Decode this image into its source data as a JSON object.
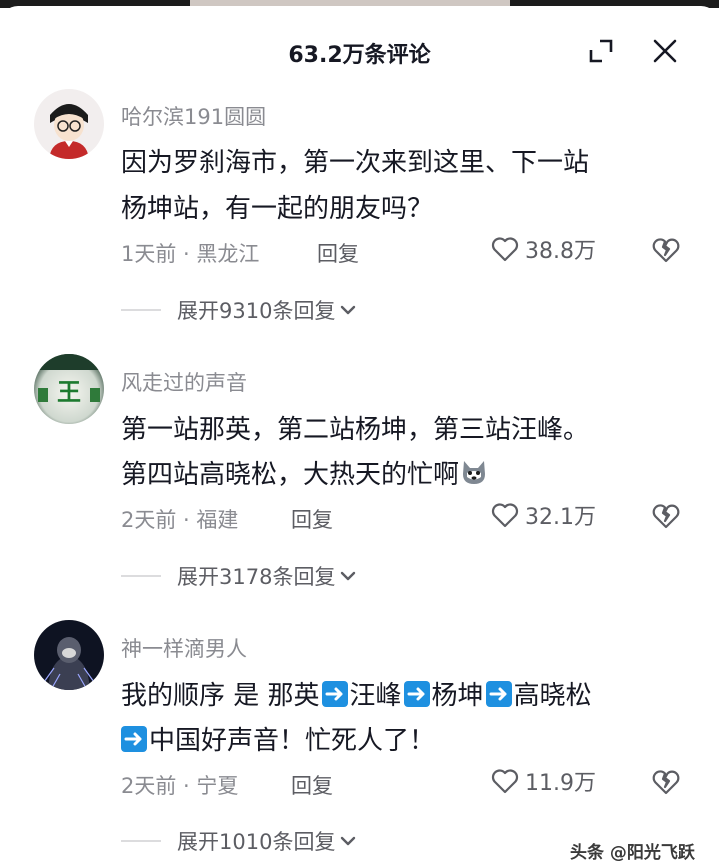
{
  "header": {
    "title": "63.2万条评论"
  },
  "icons": {
    "expand": "minimize-corner-icon",
    "close": "close-icon",
    "like": "heart-outline-icon",
    "dislike": "broken-heart-icon",
    "arrow_emoji": "right-arrow-emoji",
    "wolf_emoji": "wolf-emoji"
  },
  "comments": [
    {
      "username": "哈尔滨191圆圆",
      "lines": [
        "因为罗刹海市，第一次来到这里、下一站",
        "杨坤站，有一起的朋友吗？"
      ],
      "meta": "1天前 · 黑龙江",
      "reply_label": "回复",
      "likes": "38.8万",
      "expand_label": "展开9310条回复"
    },
    {
      "username": "风走过的声音",
      "lines": [
        "第一站那英，第二站杨坤，第三站汪峰。",
        "第四站高晓松，大热天的忙啊"
      ],
      "meta": "2天前 · 福建",
      "reply_label": "回复",
      "likes": "32.1万",
      "expand_label": "展开3178条回复"
    },
    {
      "username": "神一样滴男人",
      "segments_line1": [
        "我的顺序 是 那英",
        "汪峰",
        "杨坤",
        "高晓松"
      ],
      "segments_line2": [
        "中国好声音！忙死人了！"
      ],
      "meta": "2天前 · 宁夏",
      "reply_label": "回复",
      "likes": "11.9万",
      "expand_label": "展开1010条回复"
    }
  ],
  "watermark": "头条 @阳光飞跃",
  "colors": {
    "primary_text": "#161823",
    "secondary_text": "#8a8b91",
    "action_text": "#5c5d63",
    "emoji_arrow": "#1e90e0"
  }
}
